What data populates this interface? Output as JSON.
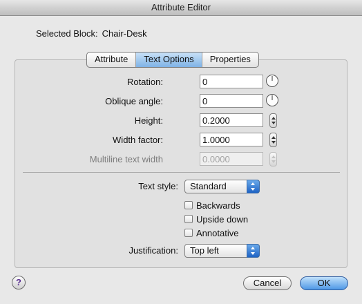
{
  "window": {
    "title": "Attribute Editor"
  },
  "selected_block": {
    "label": "Selected Block:",
    "value": "Chair-Desk"
  },
  "tabs": [
    {
      "label": "Attribute",
      "active": false
    },
    {
      "label": "Text Options",
      "active": true
    },
    {
      "label": "Properties",
      "active": false
    }
  ],
  "fields": {
    "rotation": {
      "label": "Rotation:",
      "value": "0"
    },
    "oblique_angle": {
      "label": "Oblique angle:",
      "value": "0"
    },
    "height": {
      "label": "Height:",
      "value": "0.2000"
    },
    "width_factor": {
      "label": "Width factor:",
      "value": "1.0000"
    },
    "multiline_text_width": {
      "label": "Multiline text width",
      "value": "0.0000",
      "disabled": true
    }
  },
  "text_style": {
    "label": "Text style:",
    "value": "Standard"
  },
  "checkboxes": [
    {
      "label": "Backwards",
      "checked": false
    },
    {
      "label": "Upside down",
      "checked": false
    },
    {
      "label": "Annotative",
      "checked": false
    }
  ],
  "justification": {
    "label": "Justification:",
    "value": "Top left"
  },
  "buttons": {
    "help": "?",
    "cancel": "Cancel",
    "ok": "OK"
  },
  "colors": {
    "accent": "#4f98e6",
    "help_glyph": "#5b2f91"
  }
}
